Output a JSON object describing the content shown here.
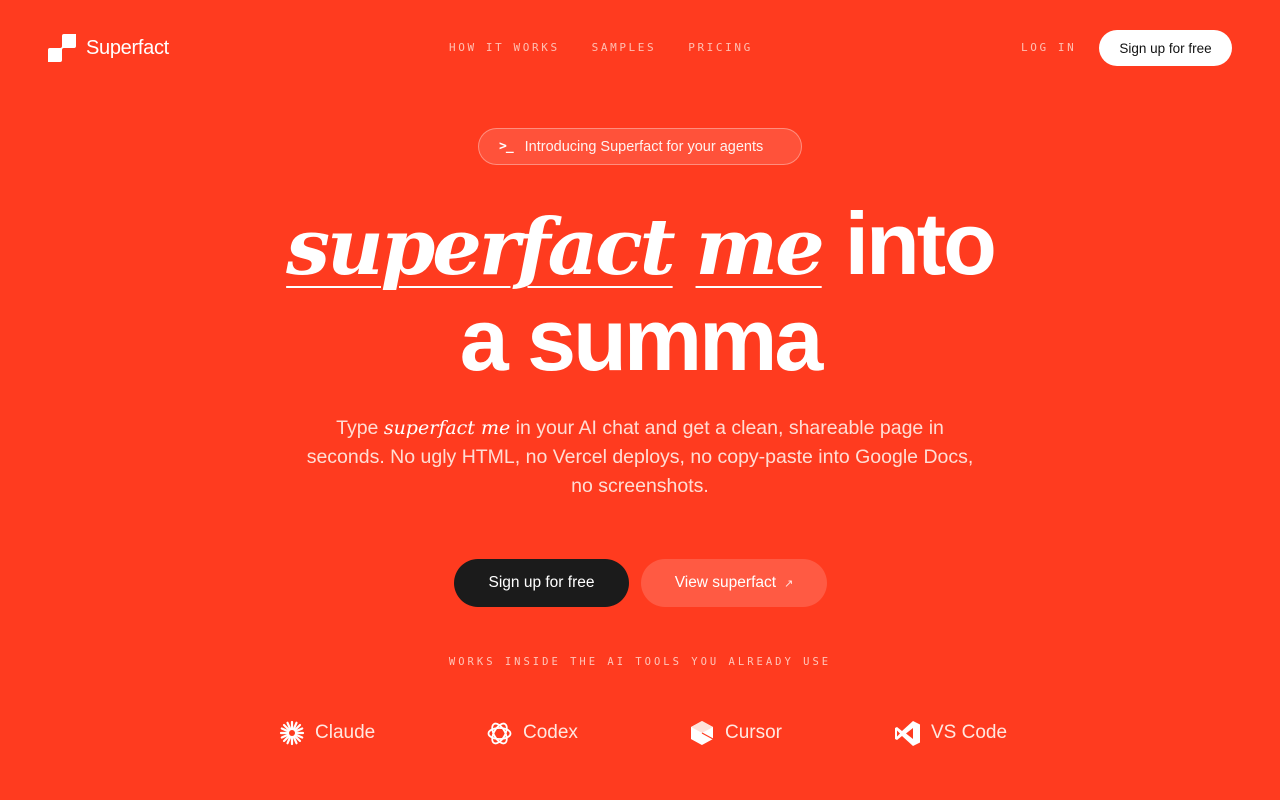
{
  "nav": {
    "brand": "Superfact",
    "links": [
      "HOW IT WORKS",
      "SAMPLES",
      "PRICING"
    ],
    "login_label": "LOG IN",
    "signup_label": "Sign up for free"
  },
  "badge": {
    "icon_text": ">_",
    "text": "Introducing Superfact for your agents"
  },
  "headline": {
    "italic_word1": "superfact",
    "italic_word2": "me",
    "plain_line1": "into",
    "line2": "a summa"
  },
  "subtext": {
    "part1": "Type ",
    "italic": "superfact me",
    "part2": " in your AI chat and get a clean, shareable page in seconds. No ugly HTML, no Vercel deploys, no copy-paste into Google Docs, no screenshots."
  },
  "cta": {
    "primary_label": "Sign up for free",
    "secondary_label": "View superfact",
    "secondary_icon": "↗"
  },
  "works": {
    "label": "WORKS INSIDE THE AI TOOLS YOU ALREADY USE",
    "tools": [
      {
        "name": "Claude",
        "icon": "claude-icon"
      },
      {
        "name": "Codex",
        "icon": "codex-icon"
      },
      {
        "name": "Cursor",
        "icon": "cursor-icon"
      },
      {
        "name": "VS Code",
        "icon": "vscode-icon"
      }
    ]
  },
  "colors": {
    "background": "#FF3B1F",
    "dark_button": "#1B1B1B",
    "white": "#FFFFFF"
  }
}
